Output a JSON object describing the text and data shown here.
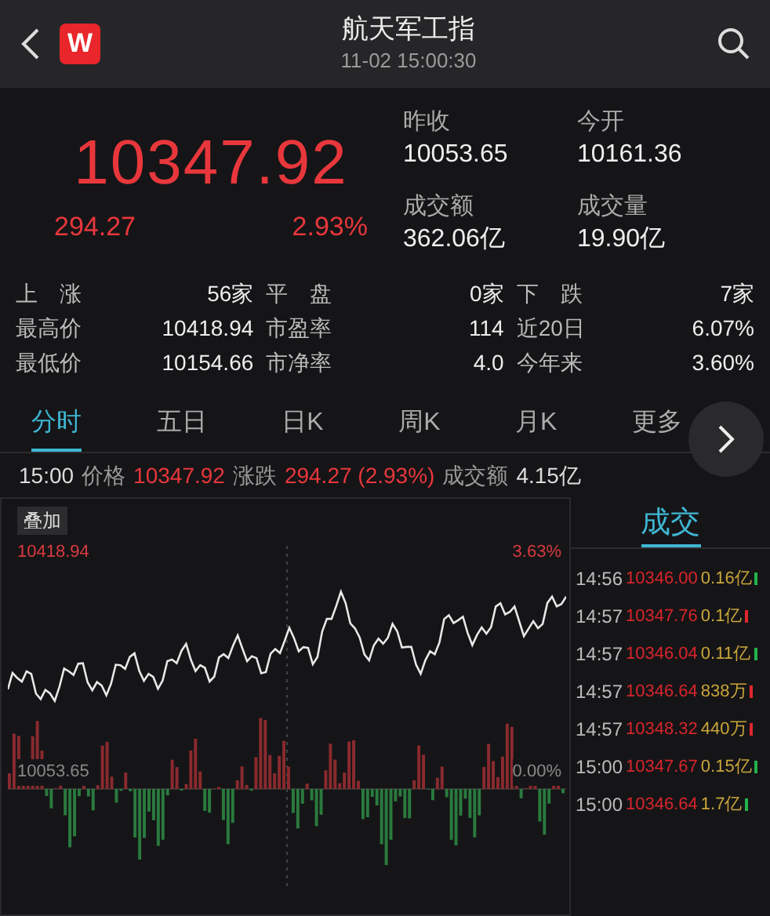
{
  "header": {
    "title": "航天军工指",
    "time": "11-02 15:00:30",
    "logo": "W"
  },
  "quote": {
    "price": "10347.92",
    "change": "294.27",
    "change_pct": "2.93%"
  },
  "summary": [
    {
      "label": "昨收",
      "value": "10053.65"
    },
    {
      "label": "今开",
      "value": "10161.36"
    },
    {
      "label": "成交额",
      "value": "362.06亿"
    },
    {
      "label": "成交量",
      "value": "19.90亿"
    }
  ],
  "stats": [
    {
      "label": "上　涨",
      "value": "56家"
    },
    {
      "label": "平　盘",
      "value": "0家"
    },
    {
      "label": "下　跌",
      "value": "7家"
    },
    {
      "label": "最高价",
      "value": "10418.94"
    },
    {
      "label": "市盈率",
      "value": "114"
    },
    {
      "label": "近20日",
      "value": "6.07%"
    },
    {
      "label": "最低价",
      "value": "10154.66"
    },
    {
      "label": "市净率",
      "value": "4.0"
    },
    {
      "label": "今年来",
      "value": "3.60%"
    }
  ],
  "tabs": [
    {
      "label": "分时",
      "selected": true
    },
    {
      "label": "五日",
      "selected": false
    },
    {
      "label": "日K",
      "selected": false
    },
    {
      "label": "周K",
      "selected": false
    },
    {
      "label": "月K",
      "selected": false
    },
    {
      "label": "更多",
      "selected": false
    }
  ],
  "info_line": {
    "time": "15:00",
    "price_label": "价格",
    "price": "10347.92",
    "change_label": "涨跌",
    "change": "294.27 (2.93%)",
    "amount_label": "成交额",
    "amount": "4.15亿"
  },
  "chart": {
    "overlay_button": "叠加",
    "high": "10418.94",
    "high_pct": "3.63%",
    "base": "10053.65",
    "base_pct": "0.00%"
  },
  "trades": {
    "title": "成交",
    "rows": [
      {
        "time": "14:56",
        "price": "10346.00",
        "amount": "0.16亿",
        "rising": false
      },
      {
        "time": "14:57",
        "price": "10347.76",
        "amount": "0.1亿",
        "rising": true
      },
      {
        "time": "14:57",
        "price": "10346.04",
        "amount": "0.11亿",
        "rising": false
      },
      {
        "time": "14:57",
        "price": "10346.64",
        "amount": "838万",
        "rising": true
      },
      {
        "time": "14:57",
        "price": "10348.32",
        "amount": "440万",
        "rising": true
      },
      {
        "time": "15:00",
        "price": "10347.67",
        "amount": "0.15亿",
        "rising": false
      },
      {
        "time": "15:00",
        "price": "10346.64",
        "amount": "1.7亿",
        "rising": false
      }
    ]
  }
}
